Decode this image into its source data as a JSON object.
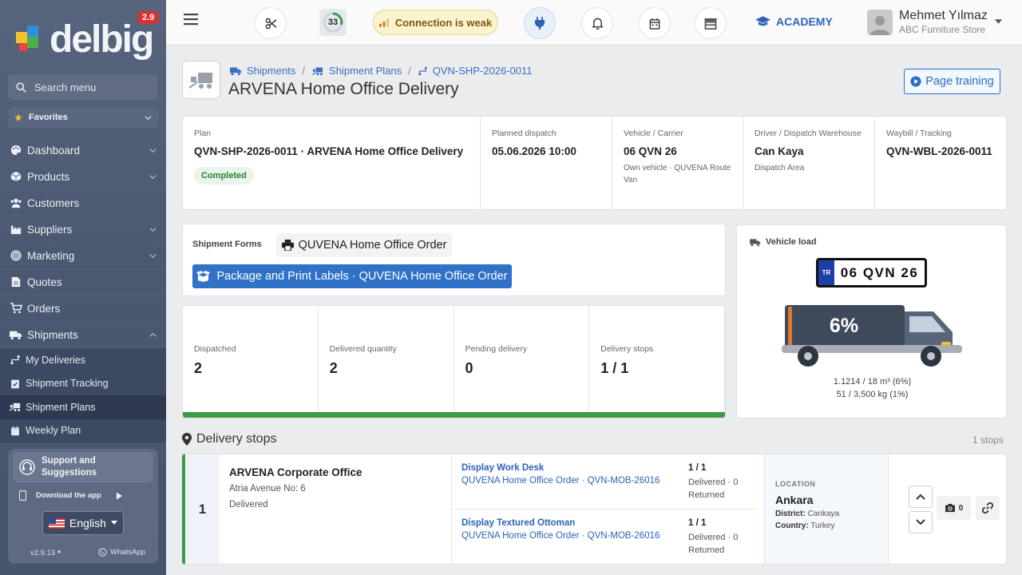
{
  "sidebar": {
    "logo_text": "delbig",
    "version_badge": "2.9",
    "search_placeholder": "Search menu",
    "favorites_label": "Favorites",
    "nav": [
      {
        "label": "Dashboard",
        "icon": "palette-icon",
        "has_children": true
      },
      {
        "label": "Products",
        "icon": "cube-icon",
        "has_children": true
      },
      {
        "label": "Customers",
        "icon": "users-icon",
        "has_children": false
      },
      {
        "label": "Suppliers",
        "icon": "industry-icon",
        "has_children": true
      },
      {
        "label": "Marketing",
        "icon": "bullseye-icon",
        "has_children": true
      },
      {
        "label": "Quotes",
        "icon": "file-icon",
        "has_children": false
      },
      {
        "label": "Orders",
        "icon": "cart-icon",
        "has_children": false
      },
      {
        "label": "Shipments",
        "icon": "truck-icon",
        "has_children": true,
        "expanded": true
      }
    ],
    "sub_items": [
      {
        "label": "My Deliveries",
        "icon": "route-icon"
      },
      {
        "label": "Shipment Tracking",
        "icon": "clipboard-check-icon"
      },
      {
        "label": "Shipment Plans",
        "icon": "truck-ramp-icon",
        "active": true
      },
      {
        "label": "Weekly Plan",
        "icon": "calendar-icon"
      }
    ],
    "support": {
      "title": "Support and Suggestions",
      "download_label": "Download the app",
      "language": "English",
      "version": "v2.9.13",
      "whatsapp": "WhatsApp"
    }
  },
  "header": {
    "score": "33",
    "connection_status": "Connection is weak",
    "academy_label": "ACADEMY",
    "user_name": "Mehmet Yılmaz",
    "store_name": "ABC Furniture Store"
  },
  "page": {
    "breadcrumb": [
      "Shipments",
      "Shipment Plans",
      "QVN-SHP-2026-0011"
    ],
    "title": "ARVENA Home Office Delivery",
    "training_button": "Page training"
  },
  "info": {
    "plan_label": "Plan",
    "plan_value": "QVN-SHP-2026-0011 · ARVENA Home Office Delivery",
    "status": "Completed",
    "dispatch_label": "Planned dispatch",
    "dispatch_value": "05.06.2026 10:00",
    "vehicle_label": "Vehicle / Carrier",
    "vehicle_value": "06 QVN 26",
    "vehicle_sub": "Own vehicle · QUVENA Route Van",
    "driver_label": "Driver / Dispatch Warehouse",
    "driver_value": "Can Kaya",
    "driver_sub": "Dispatch Area",
    "waybill_label": "Waybill / Tracking",
    "waybill_value": "QVN-WBL-2026-0011"
  },
  "forms": {
    "label": "Shipment Forms",
    "order_button": "QUVENA Home Office Order",
    "package_button": "Package and Print Labels · QUVENA Home Office Order"
  },
  "stats": [
    {
      "label": "Dispatched",
      "value": "2"
    },
    {
      "label": "Delivered quantity",
      "value": "2"
    },
    {
      "label": "Pending delivery",
      "value": "0"
    },
    {
      "label": "Delivery stops",
      "value": "1 / 1"
    }
  ],
  "progress_fraction": 1.0,
  "vehicle_load": {
    "title": "Vehicle load",
    "plate_country": "TR",
    "plate": "06 QVN 26",
    "percent_label": "6%",
    "volume": "1.1214 / 18 m³ (6%)",
    "weight": "51 / 3,500 kg (1%)"
  },
  "stops": {
    "title": "Delivery stops",
    "count_label": "1 stops",
    "items": [
      {
        "number": "1",
        "name": "ARVENA Corporate Office",
        "address": "Atria Avenue No: 6",
        "status": "Delivered",
        "lines": [
          {
            "product": "Display Work Desk",
            "order": "QUVENA Home Office Order · QVN-MOB-26016",
            "qty": "1 / 1",
            "delivered": "Delivered · 0 Returned"
          },
          {
            "product": "Display Textured Ottoman",
            "order": "QUVENA Home Office Order · QVN-MOB-26016",
            "qty": "1 / 1",
            "delivered": "Delivered · 0 Returned"
          }
        ],
        "location_label": "LOCATION",
        "city": "Ankara",
        "district_label": "District:",
        "district": "Cankaya",
        "country_label": "Country:",
        "country": "Turkey",
        "photo_count": "0"
      }
    ]
  },
  "colors": {
    "sidebar_bg": "#4a5872",
    "accent_blue": "#2f72c7",
    "success_green": "#3e9c46",
    "badge_red": "#d9332f"
  }
}
